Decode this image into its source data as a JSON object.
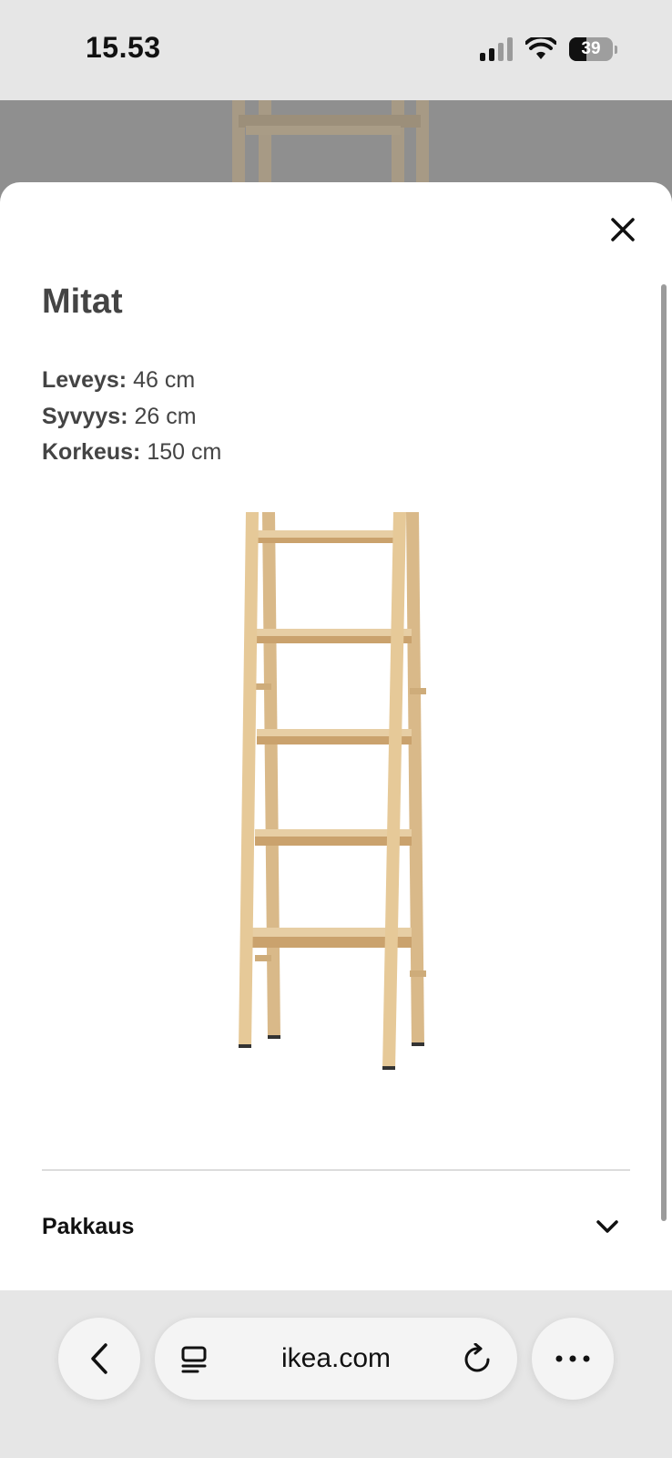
{
  "status_bar": {
    "time": "15.53",
    "battery": "39"
  },
  "sheet": {
    "title": "Mitat",
    "dimensions": [
      {
        "label": "Leveys:",
        "value": "46 cm"
      },
      {
        "label": "Syvyys:",
        "value": "26 cm"
      },
      {
        "label": "Korkeus:",
        "value": "150 cm"
      }
    ],
    "section_label": "Pakkaus"
  },
  "browser": {
    "url": "ikea.com"
  },
  "icons": {
    "close": "close-icon",
    "chevron": "chevron-down-icon",
    "back": "chevron-left-icon",
    "page_menu": "page-menu-icon",
    "reload": "reload-icon",
    "more": "more-icon"
  },
  "colors": {
    "wood": "#e3c79a",
    "wood_dark": "#cfa874",
    "text": "#444444"
  }
}
